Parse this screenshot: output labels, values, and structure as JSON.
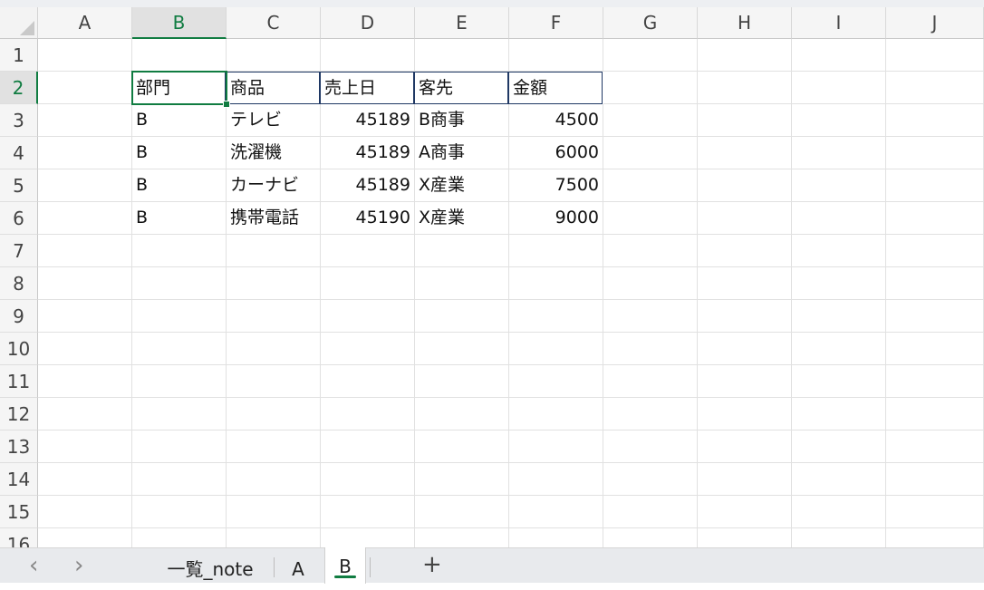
{
  "columns": [
    "A",
    "B",
    "C",
    "D",
    "E",
    "F",
    "G",
    "H",
    "I",
    "J"
  ],
  "selected_column": "B",
  "rows": [
    "1",
    "2",
    "3",
    "4",
    "5",
    "6",
    "7",
    "8",
    "9",
    "10",
    "11",
    "12",
    "13",
    "14",
    "15",
    "16"
  ],
  "selected_row": "2",
  "table": {
    "headers": [
      "部門",
      "商品",
      "売上日",
      "客先",
      "金額"
    ],
    "rows": [
      [
        "B",
        "テレビ",
        "45189",
        "B商事",
        "4500"
      ],
      [
        "B",
        "洗濯機",
        "45189",
        "A商事",
        "6000"
      ],
      [
        "B",
        "カーナビ",
        "45189",
        "X産業",
        "7500"
      ],
      [
        "B",
        "携帯電話",
        "45190",
        "X産業",
        "9000"
      ]
    ]
  },
  "active_cell": "B2",
  "sheet_tabs": [
    {
      "label": "一覧_note",
      "active": false
    },
    {
      "label": "A",
      "active": false
    },
    {
      "label": "B",
      "active": true
    }
  ],
  "nav": {
    "prev_icon": "chevron-left-icon",
    "next_icon": "chevron-right-icon",
    "prev_glyph": "‹",
    "next_glyph": "›"
  },
  "add_sheet_glyph": "+",
  "colors": {
    "accent": "#107c41",
    "table_border": "#1f3864"
  }
}
